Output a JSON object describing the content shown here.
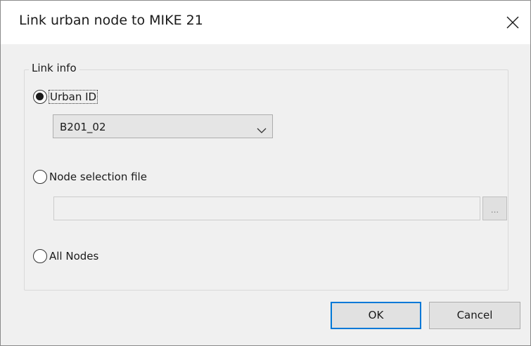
{
  "window": {
    "title": "Link urban node to MIKE 21",
    "close_icon": "close-icon"
  },
  "link_info": {
    "group_label": "Link info",
    "options": [
      {
        "label": "Urban ID",
        "checked": true
      },
      {
        "label": "Node selection file",
        "checked": false
      },
      {
        "label": "All Nodes",
        "checked": false
      }
    ],
    "urban_id": {
      "selected": "B201_02"
    },
    "node_file": {
      "value": "",
      "browse_label": "..."
    }
  },
  "buttons": {
    "ok_label": "OK",
    "cancel_label": "Cancel"
  },
  "colors": {
    "accent": "#0078d7",
    "dialog_bg": "#f0f0f0"
  }
}
